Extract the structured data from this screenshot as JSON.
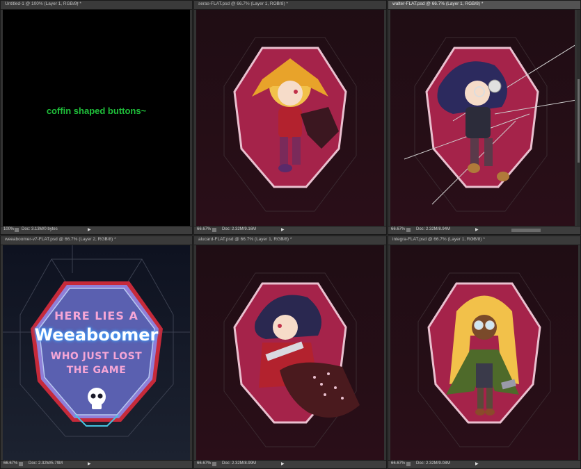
{
  "documents": [
    {
      "title": "Untitled-1 @ 100% (Layer 1, RGB/8) *",
      "zoom": "100%",
      "doc_size": "Doc: 3.13M/0 bytes",
      "caption": "coffin shaped buttons~"
    },
    {
      "title": "seras-FLAT.psd @ 66.7% (Layer 1, RGB/8) *",
      "zoom": "66.67%",
      "doc_size": "Doc: 2.32M/9.16M"
    },
    {
      "title": "walter-FLAT.psd @ 66.7% (Layer 1, RGB/8) *",
      "zoom": "66.67%",
      "doc_size": "Doc: 2.32M/8.94M"
    },
    {
      "title": "weeaboomer-v7-FLAT.psd @ 66.7% (Layer 2, RGB/8) *",
      "zoom": "66.67%",
      "doc_size": "Doc: 2.32M/5.79M",
      "coffin_text": {
        "line1": "HERE LIES A",
        "line2": "Weeaboomer",
        "line3": "WHO JUST LOST",
        "line4": "THE GAME"
      }
    },
    {
      "title": "alucard-FLAT.psd @ 66.7% (Layer 1, RGB/8) *",
      "zoom": "66.67%",
      "doc_size": "Doc: 2.32M/8.99M"
    },
    {
      "title": "integra-FLAT.psd @ 66.7% (Layer 1, RGB/8) *",
      "zoom": "66.67%",
      "doc_size": "Doc: 2.32M/9.08M"
    }
  ],
  "close_glyph": "×",
  "play_glyph": "▶",
  "colors": {
    "coffin_red": "#a5234a",
    "coffin_outline": "#e9c0cf",
    "canvas_dark": "#1c0c12",
    "caption_green": "#1fbf3a"
  }
}
